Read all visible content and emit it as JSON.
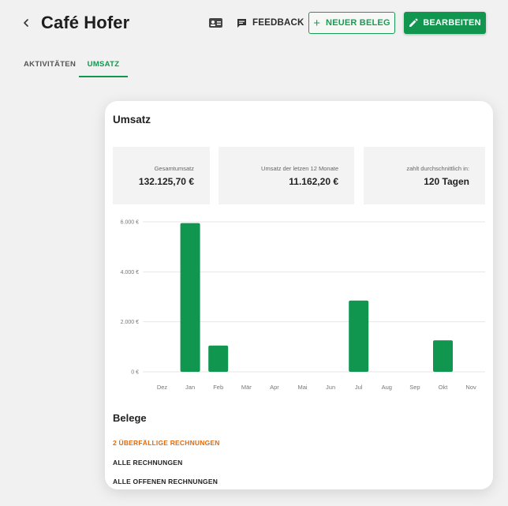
{
  "header": {
    "title": "Café Hofer",
    "feedback_label": "FEEDBACK",
    "new_receipt_label": "NEUER BELEG",
    "edit_label": "BEARBEITEN"
  },
  "tabs": [
    {
      "label": "AKTIVITÄTEN",
      "active": false
    },
    {
      "label": "UMSATZ",
      "active": true
    }
  ],
  "umsatz": {
    "title": "Umsatz",
    "stats": [
      {
        "label": "Gesamtumsatz",
        "value": "132.125,70 €"
      },
      {
        "label": "Umsatz der letzen 12 Monate",
        "value": "11.162,20 €"
      },
      {
        "label": "zahlt durchschnittlich in:",
        "value": "120 Tagen"
      }
    ]
  },
  "chart_data": {
    "type": "bar",
    "categories": [
      "Dez",
      "Jan",
      "Feb",
      "Mär",
      "Apr",
      "Mai",
      "Jun",
      "Jul",
      "Aug",
      "Sep",
      "Okt",
      "Nov"
    ],
    "values": [
      0,
      5950,
      1050,
      0,
      0,
      0,
      0,
      2850,
      0,
      0,
      1260,
      0
    ],
    "yticks": [
      "0 €",
      "2.000 €",
      "4.000 €",
      "6.000 €"
    ],
    "ylim": [
      0,
      6000
    ],
    "grid": true,
    "bar_color": "#10964f"
  },
  "belege": {
    "title": "Belege",
    "links": [
      "2 ÜBERFÄLLIGE RECHNUNGEN",
      "ALLE RECHNUNGEN",
      "ALLE OFFENEN RECHNUNGEN"
    ]
  },
  "colors": {
    "accent": "#10964f",
    "warning": "#e36a0c"
  },
  "icons": [
    "back-chevron-icon",
    "contact-card-icon",
    "feedback-icon",
    "plus-icon",
    "pencil-icon"
  ]
}
